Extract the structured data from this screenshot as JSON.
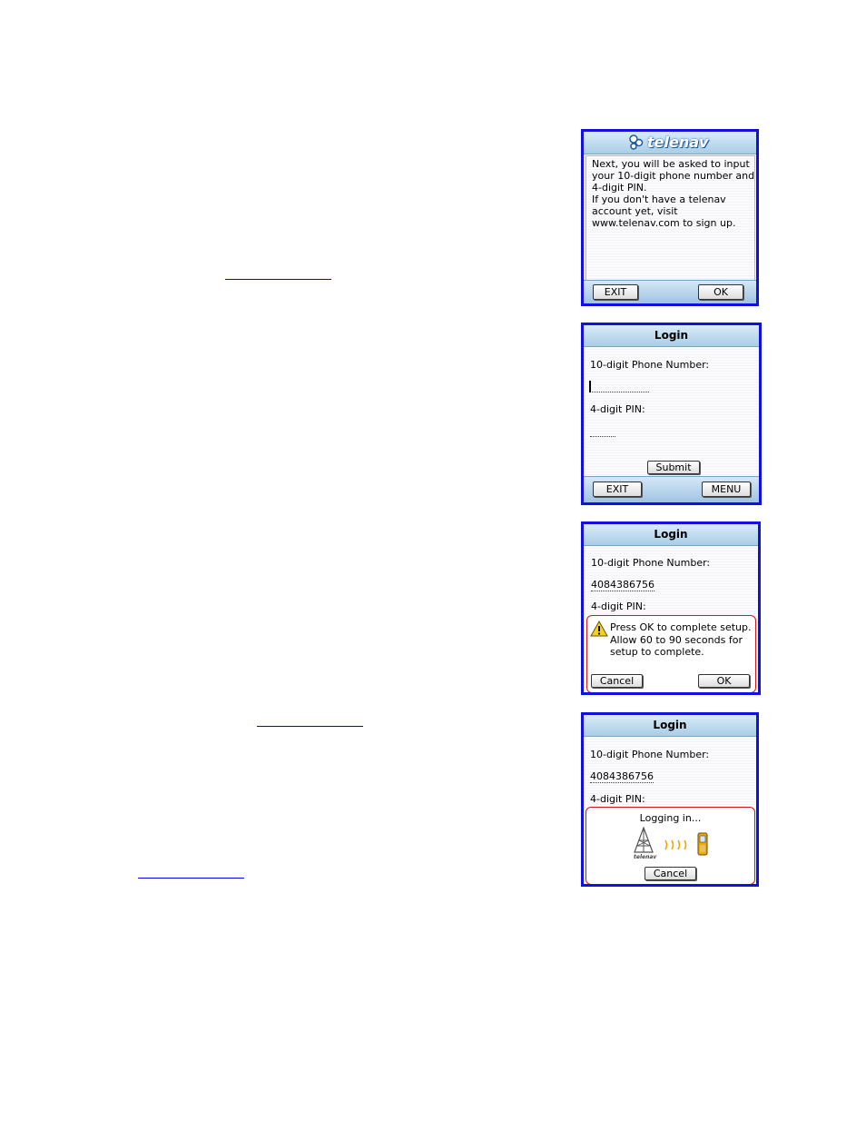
{
  "screen1": {
    "logo_text": "telenav",
    "message": "Next, you will be asked to input\nyour 10-digit phone number and\n4-digit PIN.\nIf you don't have a telenav\naccount yet, visit\nwww.telenav.com to sign up.",
    "exit_label": "EXIT",
    "ok_label": "OK"
  },
  "screen2": {
    "title": "Login",
    "phone_label": "10-digit Phone Number:",
    "pin_label": "4-digit PIN:",
    "submit_label": "Submit",
    "exit_label": "EXIT",
    "menu_label": "MENU"
  },
  "screen3": {
    "title": "Login",
    "phone_label": "10-digit Phone Number:",
    "phone_value": "4084386756",
    "pin_label": "4-digit PIN:",
    "dialog_message": "Press OK to complete setup.\nAllow 60 to 90 seconds for\nsetup to complete.",
    "cancel_label": "Cancel",
    "ok_label": "OK"
  },
  "screen4": {
    "title": "Login",
    "phone_label": "10-digit Phone Number:",
    "phone_value": "4084386756",
    "pin_label": "4-digit PIN:",
    "status_text": "Logging in...",
    "tower_brand": "telenav",
    "cancel_label": "Cancel"
  },
  "icons": {
    "logo": "telenav-logo-icon",
    "warning": "warning-icon",
    "tower": "cell-tower-icon",
    "signal": "signal-waves-icon",
    "phone": "phone-icon"
  }
}
